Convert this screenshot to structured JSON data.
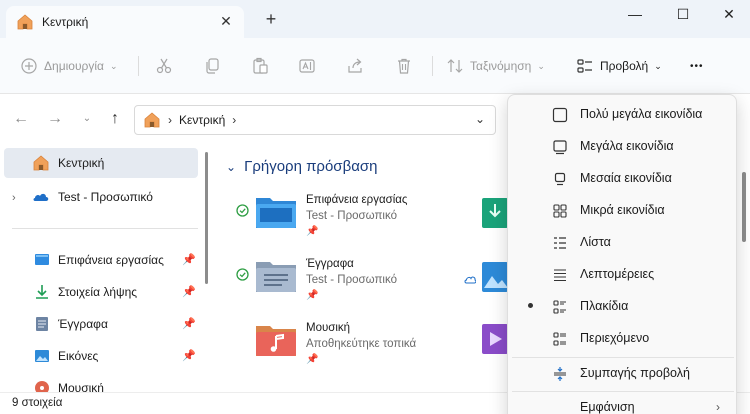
{
  "window": {
    "tab_title": "Κεντρική",
    "close_tab_glyph": "✕",
    "new_tab_glyph": "+",
    "minimize_glyph": "—",
    "maximize_glyph": "☐",
    "close_glyph": "✕"
  },
  "toolbar": {
    "new_label": "Δημιουργία",
    "sort_label": "Ταξινόμηση",
    "view_label": "Προβολή",
    "more_glyph": "•••"
  },
  "address": {
    "crumb": "Κεντρική",
    "sep": "›"
  },
  "sidebar": {
    "items": [
      {
        "label": "Κεντρική",
        "icon": "home-icon"
      },
      {
        "label": "Test - Προσωπικό",
        "icon": "onedrive-icon"
      },
      {
        "label": "Επιφάνεια εργασίας",
        "icon": "desktop-icon"
      },
      {
        "label": "Στοιχεία λήψης",
        "icon": "download-icon"
      },
      {
        "label": "Έγγραφα",
        "icon": "document-icon"
      },
      {
        "label": "Εικόνες",
        "icon": "pictures-icon"
      },
      {
        "label": "Μουσική",
        "icon": "music-icon"
      }
    ]
  },
  "main": {
    "section_title": "Γρήγορη πρόσβαση",
    "tiles": [
      {
        "name": "Επιφάνεια εργασίας",
        "sub": "Test - Προσωπικό"
      },
      {
        "name": "Έγγραφα",
        "sub": "Test - Προσωπικό"
      },
      {
        "name": "Μουσική",
        "sub": "Αποθηκεύτηκε τοπικά"
      }
    ]
  },
  "status": {
    "count": "9 στοιχεία"
  },
  "menu": {
    "items": [
      {
        "label": "Πολύ μεγάλα εικονίδια",
        "icon": "extra-large-icons-icon"
      },
      {
        "label": "Μεγάλα εικονίδια",
        "icon": "large-icons-icon"
      },
      {
        "label": "Μεσαία εικονίδια",
        "icon": "medium-icons-icon"
      },
      {
        "label": "Μικρά εικονίδια",
        "icon": "small-icons-icon"
      },
      {
        "label": "Λίστα",
        "icon": "list-icon"
      },
      {
        "label": "Λεπτομέρειες",
        "icon": "details-icon"
      },
      {
        "label": "Πλακίδια",
        "icon": "tiles-icon",
        "selected": true
      },
      {
        "label": "Περιεχόμενο",
        "icon": "content-icon"
      },
      {
        "label": "Συμπαγής προβολή",
        "icon": "compact-view-icon"
      },
      {
        "label": "Εμφάνιση",
        "icon": "show-icon"
      }
    ]
  },
  "colors": {
    "accent": "#1a3d7c",
    "folder_blue": "#3d8fd8",
    "sync_green": "#2f9e44"
  }
}
